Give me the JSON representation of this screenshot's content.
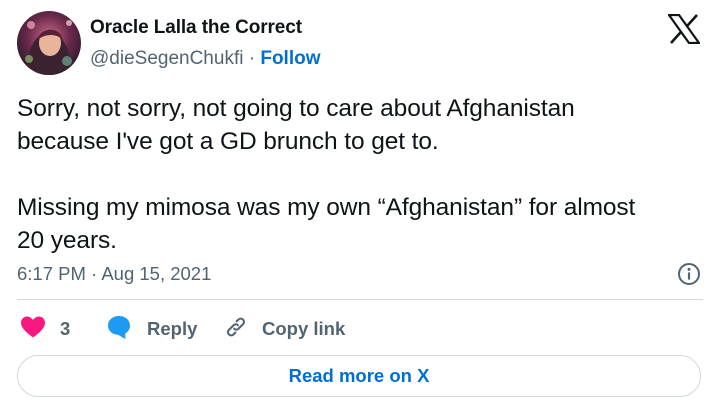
{
  "author": {
    "display_name": "Oracle Lalla the Correct",
    "handle": "@dieSegenChukfi",
    "separator": "·",
    "follow_label": "Follow"
  },
  "tweet": {
    "line1": "Sorry, not sorry, not going to care about Afghanistan",
    "line2": "because I've got a GD brunch to get to.",
    "line3": "Missing my mimosa was my own “Afghanistan” for almost",
    "line4": "20 years."
  },
  "meta": {
    "timestamp": "6:17 PM · Aug 15, 2021"
  },
  "actions": {
    "like_count": "3",
    "reply_label": "Reply",
    "copy_link_label": "Copy link"
  },
  "read_more_label": "Read more on X",
  "colors": {
    "accent": "#006fd6",
    "like": "#f91880",
    "reply": "#1d9bf0",
    "muted": "#536471",
    "border": "#cfd9de"
  },
  "icons": [
    "x-logo-icon",
    "info-icon",
    "heart-icon",
    "reply-bubble-icon",
    "link-icon"
  ]
}
